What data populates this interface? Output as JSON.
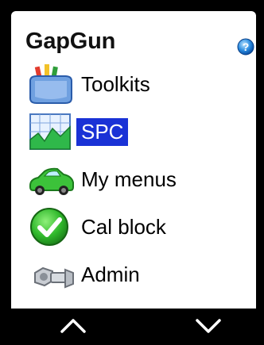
{
  "header": {
    "title": "GapGun",
    "help_icon": "help-icon"
  },
  "menu": {
    "items": [
      {
        "label": "Toolkits",
        "icon": "toolbox-icon",
        "selected": false
      },
      {
        "label": "SPC",
        "icon": "spc-chart-icon",
        "selected": true
      },
      {
        "label": "My menus",
        "icon": "car-icon",
        "selected": false
      },
      {
        "label": "Cal block",
        "icon": "checkmark-icon",
        "selected": false
      },
      {
        "label": "Admin",
        "icon": "nut-bolt-icon",
        "selected": false
      }
    ]
  },
  "footer": {
    "up_icon": "chevron-up-icon",
    "down_icon": "chevron-down-icon"
  },
  "colors": {
    "selection": "#1a32d6",
    "background": "#000000",
    "screen": "#ffffff"
  }
}
